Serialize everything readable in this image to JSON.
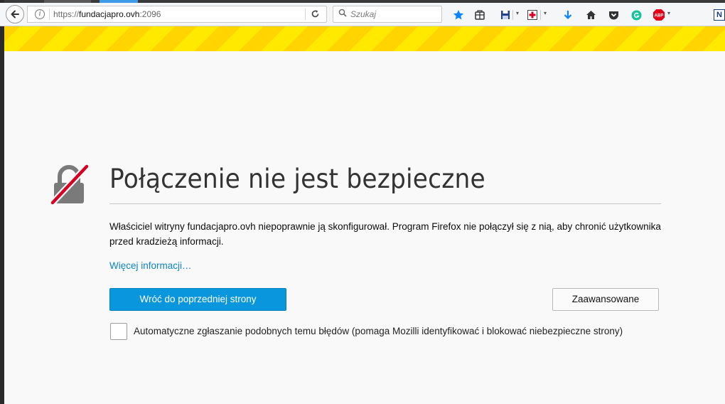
{
  "toolbar": {
    "url_scheme": "https://",
    "url_host": "fundacjapro.ovh",
    "url_port": ":2096",
    "search_placeholder": "Szukaj",
    "icons": [
      "back-arrow-icon",
      "info-icon",
      "reload-icon",
      "search-icon",
      "bookmark-star-icon",
      "reading-list-icon",
      "save-icon",
      "first-aid-icon",
      "download-arrow-icon",
      "home-icon",
      "pocket-icon",
      "grammarly-icon",
      "adblock-plus-icon",
      "extension-n-icon"
    ],
    "abp_label": "ABP",
    "ext_label": "N"
  },
  "colors": {
    "stripe_a": "#ffe900",
    "stripe_b": "#ffd400",
    "primary_button": "#0a96dc",
    "link": "#0a84c8"
  },
  "error_page": {
    "title": "Połączenie nie jest bezpieczne",
    "description": "Właściciel witryny fundacjapro.ovh niepoprawnie ją skonfigurował. Program Firefox nie połączył się z nią, aby chronić użytkownika przed kradzieżą informacji.",
    "more_info_link": "Więcej informacji…",
    "back_button": "Wróć do poprzedniej strony",
    "advanced_button": "Zaawansowane",
    "report_checkbox_label": "Automatyczne zgłaszanie podobnych temu błędów (pomaga Mozilli identyfikować i blokować niebezpieczne strony)"
  }
}
